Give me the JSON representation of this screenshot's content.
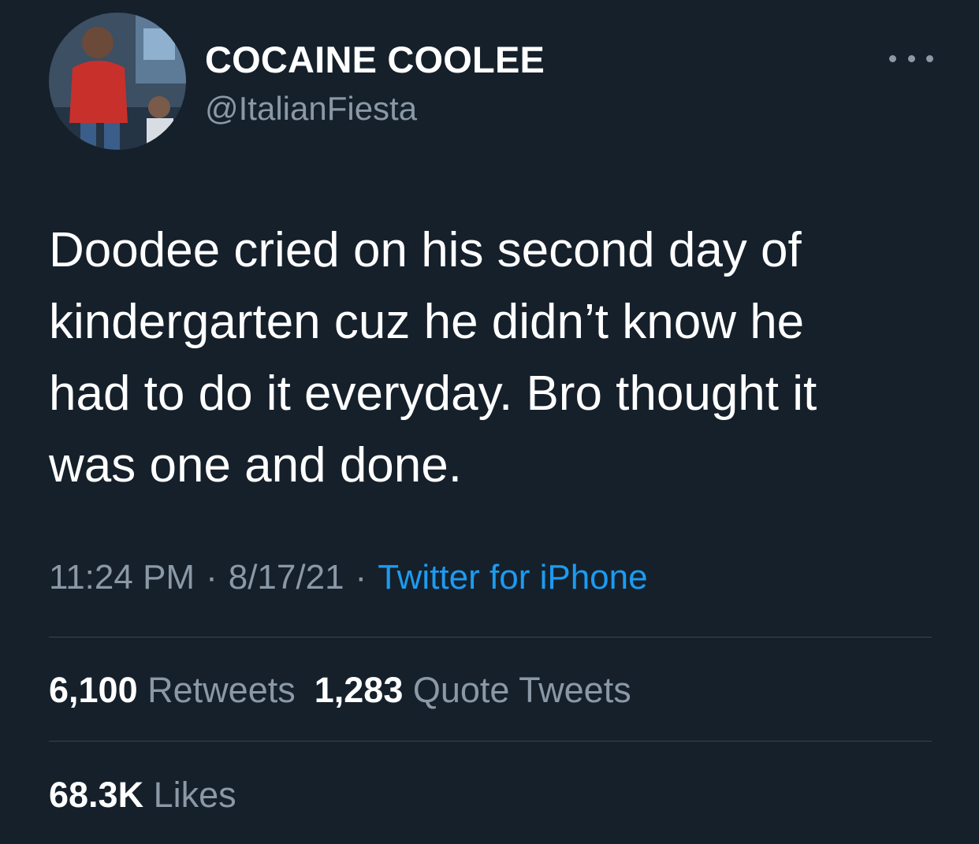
{
  "author": {
    "display_name": "COCAINE COOLEE",
    "handle": "@ItalianFiesta",
    "avatar_icon": "profile-photo"
  },
  "menu": {
    "more_icon": "more-horizontal-icon"
  },
  "tweet": {
    "text_lines": [
      "Doodee cried on his second day of",
      "kindergarten cuz he didn’t know he",
      "had to do it everyday. Bro thought it",
      "was one and done."
    ],
    "time": "11:24 PM",
    "date": "8/17/21",
    "separator": "·",
    "source": "Twitter for iPhone"
  },
  "stats": {
    "retweets_count": "6,100",
    "retweets_label": "Retweets",
    "quotes_count": "1,283",
    "quotes_label": "Quote Tweets",
    "likes_count": "68.3K",
    "likes_label": "Likes"
  },
  "colors": {
    "background": "#15202b",
    "primary_text": "#ffffff",
    "secondary_text": "#8b98a5",
    "link": "#1d9bf0",
    "divider": "#38444d"
  }
}
